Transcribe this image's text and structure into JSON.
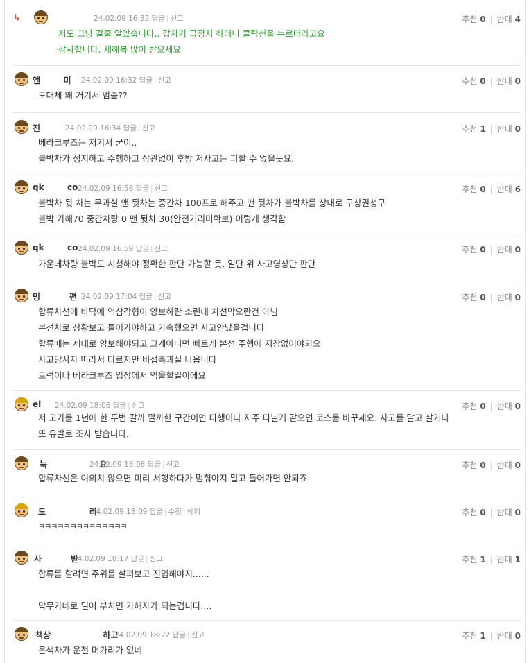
{
  "ui": {
    "reply_label": "답글",
    "report_label": "신고",
    "edit_label": "수정",
    "delete_label": "삭제",
    "up_label": "추천",
    "down_label": "반대",
    "reply_arrow": "↳"
  },
  "comments": [
    {
      "nick": "",
      "date": "24.02.09 16:32",
      "up": "0",
      "down": "4",
      "lines": [
        "저도 그냥 갈줄 알았습니다.. 갑자기 급정지 하더니 클락션을 누르더라고요",
        "감사합니다. 새해복 많이 받으세요"
      ]
    },
    {
      "nick": "앤        미",
      "date": "24.02.09 16:32",
      "up": "0",
      "down": "0",
      "lines": [
        "도대체 왜 거기서 멈춤??"
      ]
    },
    {
      "nick": "진",
      "date": "24.02.09 16:34",
      "up": "1",
      "down": "0",
      "lines": [
        "베라크루즈는 저기서 굳이..",
        "블박차가 정지하고 주행하고 상관없이 후방 저사고는 피할 수 없을듯요."
      ]
    },
    {
      "nick": "qk        co",
      "date": "24.02.09 16:56",
      "up": "0",
      "down": "6",
      "lines": [
        "블박차 뒷 차는 무과실 맨 뒷차는 중간차 100프로 해주고 맨 뒷차가 블박차를 상대로 구상권청구",
        "블박 가해70 중간차량 0 맨 뒷차 30(안전거리미확보) 이렇게 생각함"
      ]
    },
    {
      "nick": "qk        co",
      "date": "24.02.09 16:59",
      "up": "0",
      "down": "0",
      "lines": [
        "가운데차량 블박도 시청해야 정확한 판단 가능할 듯. 일단 위 사고영상만 판단"
      ]
    },
    {
      "nick": "밍          편",
      "date": "24.02.09 17:04",
      "up": "0",
      "down": "0",
      "lines": [
        "합류차선에 바닥에 역삼각형이 양보하란 소린데 차선막으란건 아님",
        "본선차로 상황보고 들어가야하고 가속했으면 사고안났을겁니다",
        "합류때는 제대로 양보해야되고 그게아니면 빠르게 본선 주행에 지장없어야되요",
        "사고당사자 따라서 다르지만 비접촉과실 나옵니다",
        "트럭이나 베라크루즈 입장에서 억울할일이에요"
      ]
    },
    {
      "nick": "ei",
      "date": "24.02.09 18:06",
      "up": "0",
      "down": "0",
      "lines": [
        "저 고가를 1년에 한 두번 갈까 말까한 구간이면 다행이나 자주 다닐거 같으면 코스를 바꾸세요. 사고를 달고 살거나",
        "또 유발로 조사 받습니다."
      ]
    },
    {
      "nick": "늑                  요",
      "date": "24.02.09 18:08",
      "up": "0",
      "down": "0",
      "lines": [
        "합류차선은 여의치 않으면 미리 서행하다가 멈춰야지 밀고 들어가면 안되죠"
      ]
    },
    {
      "nick": "도               리",
      "date": "24.02.09 18:09",
      "up": "0",
      "down": "0",
      "lines": [
        "ㅋㅋㅋㅋㅋㅋㅋㅋㅋㅋㅋㅋㅋㅋ"
      ]
    },
    {
      "nick": "사          반",
      "date": "24.02.09 18:17",
      "up": "1",
      "down": "1",
      "lines": [
        "합류를 할려면 주위를 살펴보고 진입해야지......",
        "",
        "막무가네로 밀어 부치면 가해자가 되는겁니다...."
      ]
    },
    {
      "nick": "책상                  하고",
      "date": "24.02.09 18:22",
      "up": "1",
      "down": "0",
      "lines": [
        "은색차가 운전 머가리가 없네"
      ]
    }
  ]
}
